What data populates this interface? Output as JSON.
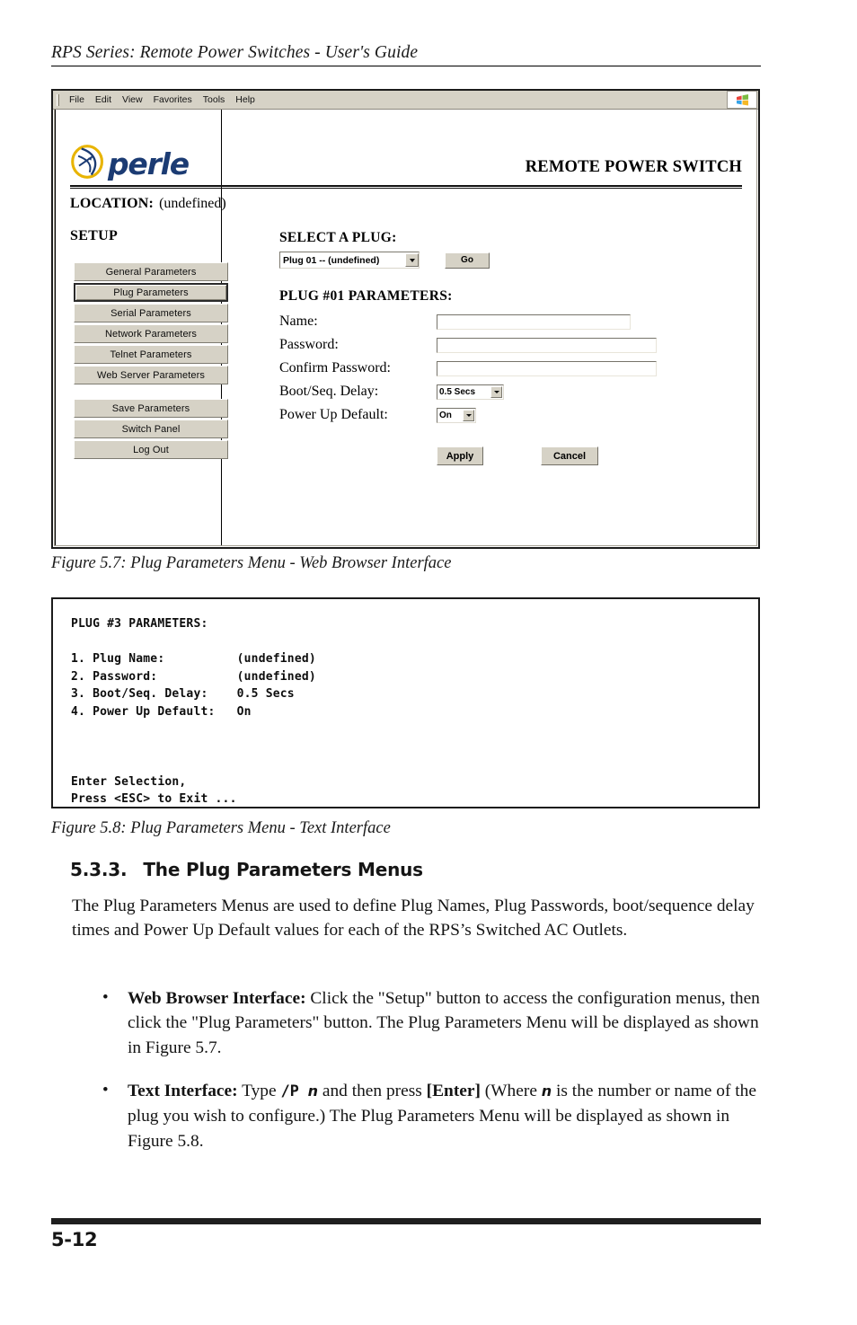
{
  "page": {
    "running_header": "RPS Series: Remote Power Switches - User's Guide",
    "page_number": "5-12"
  },
  "figure_57": {
    "caption": "Figure 5.7:  Plug Parameters Menu - Web Browser Interface",
    "browser": {
      "menus": [
        "File",
        "Edit",
        "View",
        "Favorites",
        "Tools",
        "Help"
      ],
      "brand_icon": "windows-flag-icon"
    },
    "brand": {
      "logo_mark": "perle-swoosh-icon",
      "logo_word": "perle",
      "product_title": "REMOTE POWER SWITCH"
    },
    "location": {
      "label": "LOCATION:",
      "value": "(undefined)"
    },
    "setup": {
      "label": "SETUP",
      "nav_primary": [
        "General Parameters",
        "Plug Parameters",
        "Serial Parameters",
        "Network Parameters",
        "Telnet Parameters",
        "Web Server Parameters"
      ],
      "selected": "Plug Parameters",
      "nav_secondary": [
        "Save Parameters",
        "Switch Panel",
        "Log Out"
      ]
    },
    "select_plug": {
      "heading": "SELECT A PLUG:",
      "selected_option": "Plug 01 -- (undefined)",
      "go_label": "Go"
    },
    "plug_params": {
      "heading": "PLUG #01 PARAMETERS:",
      "fields": {
        "name_label": "Name:",
        "name_value": "",
        "password_label": "Password:",
        "password_value": "",
        "confirm_label": "Confirm Password:",
        "confirm_value": "",
        "delay_label": "Boot/Seq. Delay:",
        "delay_value": "0.5 Secs",
        "power_label": "Power Up Default:",
        "power_value": "On"
      },
      "apply_label": "Apply",
      "cancel_label": "Cancel"
    }
  },
  "figure_58": {
    "caption": "Figure 5.8:  Plug Parameters Menu - Text Interface",
    "terminal_text": "PLUG #3 PARAMETERS:\n\n1. Plug Name:          (undefined)\n2. Password:           (undefined)\n3. Boot/Seq. Delay:    0.5 Secs\n4. Power Up Default:   On\n\n\n\nEnter Selection,\nPress <ESC> to Exit ..."
  },
  "section": {
    "number": "5.3.3.",
    "title": "The Plug Parameters Menus",
    "intro": "The Plug Parameters Menus are used to define Plug Names, Plug Passwords, boot/sequence delay times and Power Up Default values for each of the RPS’s Switched AC Outlets.",
    "bullets": [
      {
        "lead": "Web Browser Interface:",
        "body": "  Click the \"Setup\" button to access the configuration menus, then click the \"Plug Parameters\" button.  The Plug Parameters Menu will be displayed as shown in Figure 5.7."
      },
      {
        "lead": "Text Interface:",
        "body_1": "  Type ",
        "cmd": "/P",
        "var_1": "n",
        "body_2": " and then press ",
        "key": "[Enter]",
        "body_3": " (Where ",
        "var_2": "n",
        "body_4": " is the number or name of the plug you wish to configure.)  The Plug Parameters Menu will be displayed as shown in Figure 5.8."
      }
    ]
  },
  "colors": {
    "logo_gold": "#e8b400",
    "logo_navy": "#1b3b73",
    "button_face": "#d6d2c6",
    "rule_black": "#1f1f1f"
  }
}
